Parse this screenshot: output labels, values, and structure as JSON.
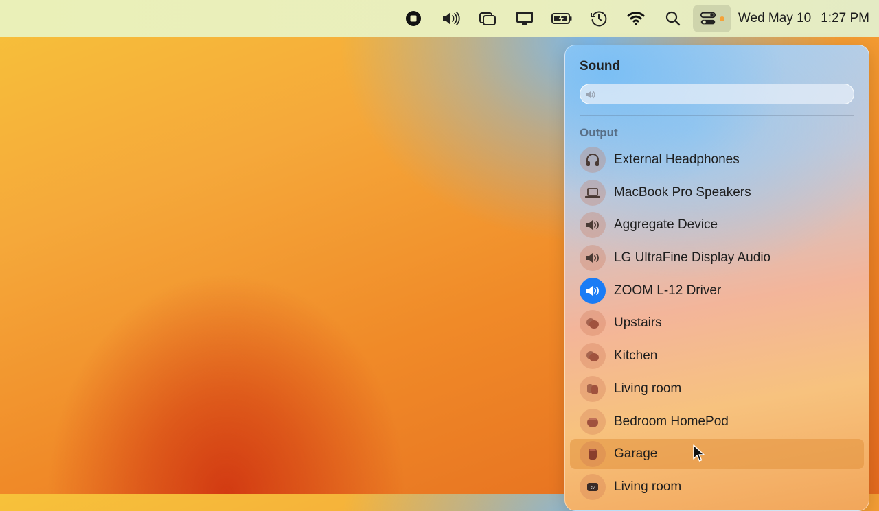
{
  "menubar": {
    "icons": [
      "stop-record-icon",
      "volume-icon",
      "window-overlap-icon",
      "display-icon",
      "battery-charging-icon",
      "time-machine-icon",
      "wifi-icon",
      "search-icon",
      "control-center-icon"
    ],
    "date": "Wed May 10",
    "time": "1:27 PM"
  },
  "sound_panel": {
    "title": "Sound",
    "volume_level_fraction": 0.0,
    "output_label": "Output",
    "devices": [
      {
        "label": "External Headphones",
        "icon": "headphones-icon",
        "selected": false
      },
      {
        "label": "MacBook Pro Speakers",
        "icon": "laptop-icon",
        "selected": false
      },
      {
        "label": "Aggregate Device",
        "icon": "speaker-icon",
        "selected": false
      },
      {
        "label": "LG UltraFine Display Audio",
        "icon": "speaker-icon",
        "selected": false
      },
      {
        "label": "ZOOM L-12 Driver",
        "icon": "speaker-icon",
        "selected": true
      },
      {
        "label": "Upstairs",
        "icon": "homepod-group-icon",
        "selected": false
      },
      {
        "label": "Kitchen",
        "icon": "homepod-group-icon",
        "selected": false
      },
      {
        "label": "Living room",
        "icon": "homepod-group-icon",
        "selected": false
      },
      {
        "label": "Bedroom HomePod",
        "icon": "homepod-mini-icon",
        "selected": false
      },
      {
        "label": "Garage",
        "icon": "homepod-icon",
        "selected": false,
        "hovered": true
      },
      {
        "label": "Living room",
        "icon": "appletv-icon",
        "selected": false
      }
    ]
  },
  "colors": {
    "accent_selected": "#1a7cf5",
    "hover_row": "#e2913c"
  }
}
